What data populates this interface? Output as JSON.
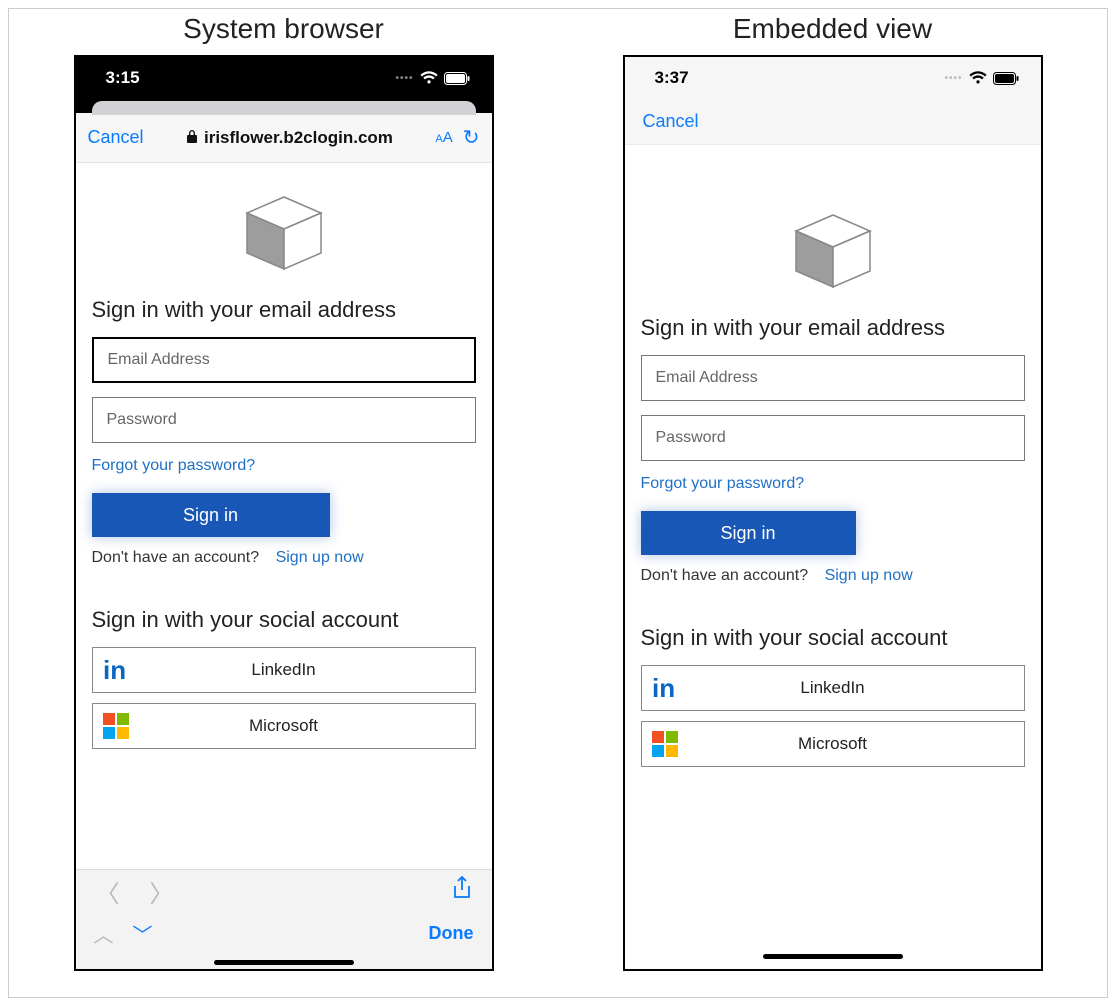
{
  "titles": {
    "left": "System browser",
    "right": "Embedded view"
  },
  "status": {
    "left_time": "3:15",
    "right_time": "3:37"
  },
  "safari": {
    "cancel": "Cancel",
    "domain": "irisflower.b2clogin.com",
    "aa_small": "A",
    "aa_big": "A",
    "done": "Done"
  },
  "embed": {
    "cancel": "Cancel"
  },
  "signin": {
    "heading": "Sign in with your email address",
    "email_placeholder": "Email Address",
    "password_placeholder": "Password",
    "forgot": "Forgot your password?",
    "button": "Sign in",
    "no_account": "Don't have an account?",
    "signup": "Sign up now"
  },
  "social": {
    "heading": "Sign in with your social account",
    "linkedin": "LinkedIn",
    "microsoft": "Microsoft"
  }
}
